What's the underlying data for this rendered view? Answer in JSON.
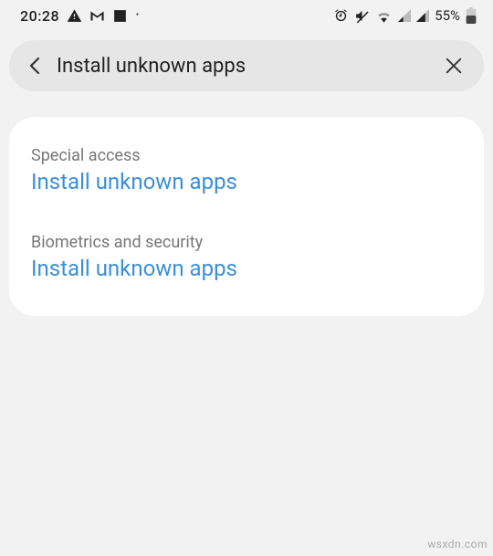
{
  "status": {
    "time": "20:28",
    "battery_pct": "55%",
    "icons_left": [
      "warning",
      "gmail",
      "image",
      "dot"
    ],
    "icons_right": [
      "alarm",
      "mute",
      "wifi",
      "signal1",
      "signal2",
      "battery"
    ]
  },
  "search": {
    "query": "Install unknown apps"
  },
  "results": [
    {
      "category": "Special access",
      "title": "Install unknown apps"
    },
    {
      "category": "Biometrics and security",
      "title": "Install unknown apps"
    }
  ],
  "watermark": "wsxdn.com"
}
